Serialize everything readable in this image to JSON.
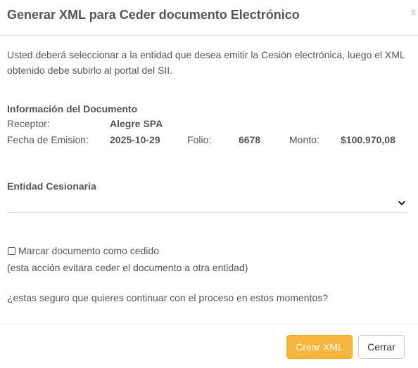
{
  "modal": {
    "title": "Generar XML para Ceder documento Electrónico",
    "close_label": "x",
    "intro": "Usted deberá seleccionar a la entidad que desea emitir la Cesión electrónica, luego el XML obtenido debe subirlo al portal del SII."
  },
  "document_info": {
    "section_title": "Información del Documento",
    "receptor_label": "Receptor:",
    "receptor_value": "Alegre SPA",
    "fecha_label": "Fecha de Emision:",
    "fecha_value": "2025-10-29",
    "folio_label": "Folio:",
    "folio_value": "6678",
    "monto_label": "Monto:",
    "monto_value": "$100.970,08"
  },
  "entidad": {
    "section_title": "Entidad Cesionaria",
    "selected_value": ""
  },
  "checkbox": {
    "label": "Marcar documento como cedido",
    "checked": false,
    "note": "(esta acción evitara ceder el documento a otra entidad)"
  },
  "question": "¿estas seguro que quieres continuar con el proceso en estos momentos?",
  "footer": {
    "primary_label": "Crear XML",
    "secondary_label": "Cerrar",
    "primary_color": "#f8b53d"
  }
}
